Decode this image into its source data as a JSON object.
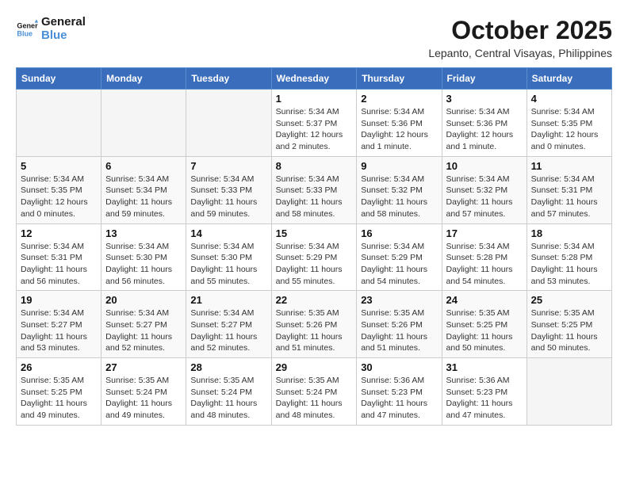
{
  "header": {
    "logo_line1": "General",
    "logo_line2": "Blue",
    "month_title": "October 2025",
    "location": "Lepanto, Central Visayas, Philippines"
  },
  "weekdays": [
    "Sunday",
    "Monday",
    "Tuesday",
    "Wednesday",
    "Thursday",
    "Friday",
    "Saturday"
  ],
  "weeks": [
    [
      {
        "day": "",
        "info": ""
      },
      {
        "day": "",
        "info": ""
      },
      {
        "day": "",
        "info": ""
      },
      {
        "day": "1",
        "info": "Sunrise: 5:34 AM\nSunset: 5:37 PM\nDaylight: 12 hours\nand 2 minutes."
      },
      {
        "day": "2",
        "info": "Sunrise: 5:34 AM\nSunset: 5:36 PM\nDaylight: 12 hours\nand 1 minute."
      },
      {
        "day": "3",
        "info": "Sunrise: 5:34 AM\nSunset: 5:36 PM\nDaylight: 12 hours\nand 1 minute."
      },
      {
        "day": "4",
        "info": "Sunrise: 5:34 AM\nSunset: 5:35 PM\nDaylight: 12 hours\nand 0 minutes."
      }
    ],
    [
      {
        "day": "5",
        "info": "Sunrise: 5:34 AM\nSunset: 5:35 PM\nDaylight: 12 hours\nand 0 minutes."
      },
      {
        "day": "6",
        "info": "Sunrise: 5:34 AM\nSunset: 5:34 PM\nDaylight: 11 hours\nand 59 minutes."
      },
      {
        "day": "7",
        "info": "Sunrise: 5:34 AM\nSunset: 5:33 PM\nDaylight: 11 hours\nand 59 minutes."
      },
      {
        "day": "8",
        "info": "Sunrise: 5:34 AM\nSunset: 5:33 PM\nDaylight: 11 hours\nand 58 minutes."
      },
      {
        "day": "9",
        "info": "Sunrise: 5:34 AM\nSunset: 5:32 PM\nDaylight: 11 hours\nand 58 minutes."
      },
      {
        "day": "10",
        "info": "Sunrise: 5:34 AM\nSunset: 5:32 PM\nDaylight: 11 hours\nand 57 minutes."
      },
      {
        "day": "11",
        "info": "Sunrise: 5:34 AM\nSunset: 5:31 PM\nDaylight: 11 hours\nand 57 minutes."
      }
    ],
    [
      {
        "day": "12",
        "info": "Sunrise: 5:34 AM\nSunset: 5:31 PM\nDaylight: 11 hours\nand 56 minutes."
      },
      {
        "day": "13",
        "info": "Sunrise: 5:34 AM\nSunset: 5:30 PM\nDaylight: 11 hours\nand 56 minutes."
      },
      {
        "day": "14",
        "info": "Sunrise: 5:34 AM\nSunset: 5:30 PM\nDaylight: 11 hours\nand 55 minutes."
      },
      {
        "day": "15",
        "info": "Sunrise: 5:34 AM\nSunset: 5:29 PM\nDaylight: 11 hours\nand 55 minutes."
      },
      {
        "day": "16",
        "info": "Sunrise: 5:34 AM\nSunset: 5:29 PM\nDaylight: 11 hours\nand 54 minutes."
      },
      {
        "day": "17",
        "info": "Sunrise: 5:34 AM\nSunset: 5:28 PM\nDaylight: 11 hours\nand 54 minutes."
      },
      {
        "day": "18",
        "info": "Sunrise: 5:34 AM\nSunset: 5:28 PM\nDaylight: 11 hours\nand 53 minutes."
      }
    ],
    [
      {
        "day": "19",
        "info": "Sunrise: 5:34 AM\nSunset: 5:27 PM\nDaylight: 11 hours\nand 53 minutes."
      },
      {
        "day": "20",
        "info": "Sunrise: 5:34 AM\nSunset: 5:27 PM\nDaylight: 11 hours\nand 52 minutes."
      },
      {
        "day": "21",
        "info": "Sunrise: 5:34 AM\nSunset: 5:27 PM\nDaylight: 11 hours\nand 52 minutes."
      },
      {
        "day": "22",
        "info": "Sunrise: 5:35 AM\nSunset: 5:26 PM\nDaylight: 11 hours\nand 51 minutes."
      },
      {
        "day": "23",
        "info": "Sunrise: 5:35 AM\nSunset: 5:26 PM\nDaylight: 11 hours\nand 51 minutes."
      },
      {
        "day": "24",
        "info": "Sunrise: 5:35 AM\nSunset: 5:25 PM\nDaylight: 11 hours\nand 50 minutes."
      },
      {
        "day": "25",
        "info": "Sunrise: 5:35 AM\nSunset: 5:25 PM\nDaylight: 11 hours\nand 50 minutes."
      }
    ],
    [
      {
        "day": "26",
        "info": "Sunrise: 5:35 AM\nSunset: 5:25 PM\nDaylight: 11 hours\nand 49 minutes."
      },
      {
        "day": "27",
        "info": "Sunrise: 5:35 AM\nSunset: 5:24 PM\nDaylight: 11 hours\nand 49 minutes."
      },
      {
        "day": "28",
        "info": "Sunrise: 5:35 AM\nSunset: 5:24 PM\nDaylight: 11 hours\nand 48 minutes."
      },
      {
        "day": "29",
        "info": "Sunrise: 5:35 AM\nSunset: 5:24 PM\nDaylight: 11 hours\nand 48 minutes."
      },
      {
        "day": "30",
        "info": "Sunrise: 5:36 AM\nSunset: 5:23 PM\nDaylight: 11 hours\nand 47 minutes."
      },
      {
        "day": "31",
        "info": "Sunrise: 5:36 AM\nSunset: 5:23 PM\nDaylight: 11 hours\nand 47 minutes."
      },
      {
        "day": "",
        "info": ""
      }
    ]
  ]
}
